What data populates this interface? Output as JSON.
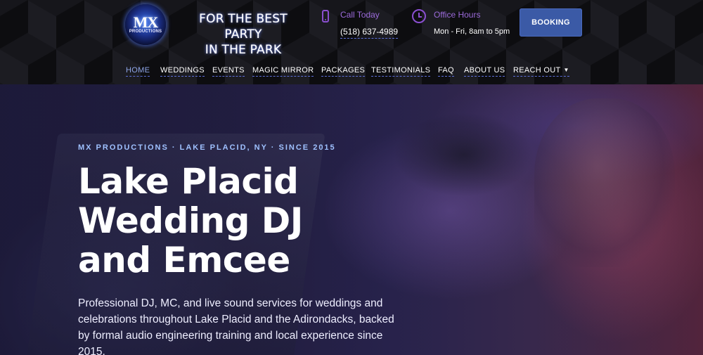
{
  "header": {
    "logo": {
      "mark": "MX",
      "sub": "PRODUCTIONS"
    },
    "tagline": {
      "line1": "FOR THE BEST PARTY",
      "line2": "IN THE PARK"
    },
    "call": {
      "icon": "phone-icon",
      "label": "Call Today",
      "value": "(518) 637-4989"
    },
    "hours": {
      "icon": "clock-icon",
      "label": "Office Hours",
      "value": "Mon - Fri, 8am to 5pm"
    },
    "booking_label": "BOOKING"
  },
  "nav": {
    "items": [
      {
        "label": "HOME",
        "active": true
      },
      {
        "label": "WEDDINGS"
      },
      {
        "label": "EVENTS"
      },
      {
        "label": "MAGIC MIRROR"
      },
      {
        "label": "PACKAGES"
      },
      {
        "label": "TESTIMONIALS"
      },
      {
        "label": "FAQ"
      },
      {
        "label": "ABOUT US"
      },
      {
        "label": "REACH OUT",
        "icon": "chevron-down-icon"
      }
    ]
  },
  "hero": {
    "eyebrow": "MX PRODUCTIONS · LAKE PLACID, NY · SINCE 2015",
    "title_lines": [
      "Lake Placid",
      "Wedding DJ",
      "and Emcee"
    ],
    "description": "Professional DJ, MC, and live sound services for weddings and celebrations throughout Lake Placid and the Adirondacks, backed by formal audio engineering training and local experience since 2015."
  },
  "colors": {
    "accent_purple": "#8a4fd0",
    "booking_blue": "#3b5aa6",
    "eyebrow_blue": "#9fc1ff",
    "nav_active": "#8fa6e8"
  }
}
